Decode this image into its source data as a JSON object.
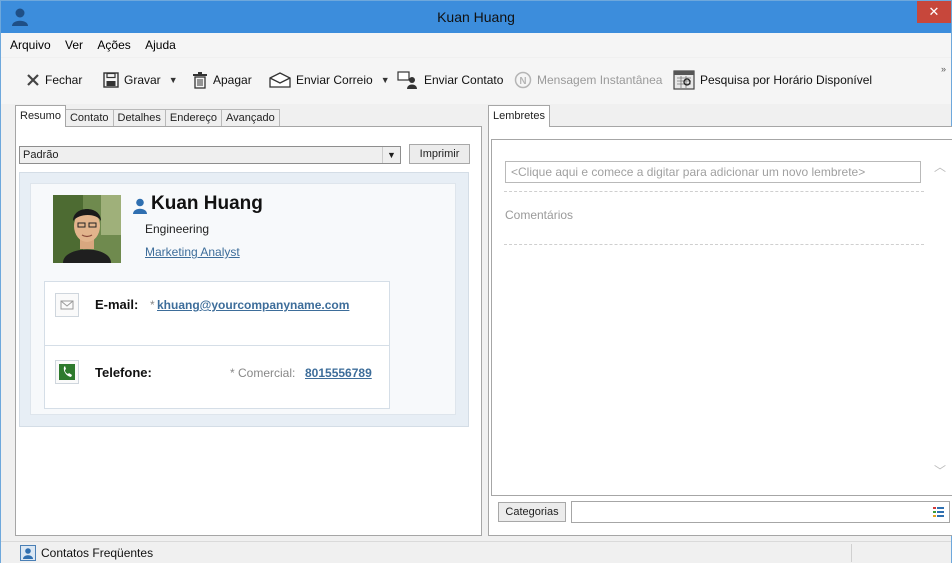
{
  "window": {
    "title": "Kuan Huang",
    "close_glyph": "✕",
    "accent": "#3c8ddc"
  },
  "menu": [
    "Arquivo",
    "Ver",
    "Ações",
    "Ajuda"
  ],
  "toolbar": {
    "close_label": "Fechar",
    "save_label": "Gravar",
    "delete_label": "Apagar",
    "send_mail_label": "Enviar Correio",
    "send_contact_label": "Enviar Contato",
    "im_label": "Mensagem Instantânea",
    "availability_label": "Pesquisa por Horário Disponível",
    "more_glyph": "»"
  },
  "left": {
    "tabs": [
      "Resumo",
      "Contato",
      "Detalhes",
      "Endereço",
      "Avançado"
    ],
    "view_value": "Padrão",
    "print_label": "Imprimir",
    "card": {
      "name": "Kuan Huang",
      "department": "Engineering",
      "role": "Marketing Analyst",
      "email_label": "E-mail:",
      "email_star": "*",
      "email": "khuang@yourcompanyname.com",
      "phone_label": "Telefone:",
      "phone_type": "* Comercial:",
      "phone": "8015556789"
    }
  },
  "right": {
    "tab": "Lembretes",
    "reminder_placeholder": "<Clique aqui e comece a digitar para adicionar um novo lembrete>",
    "comments_label": "Comentários",
    "categories_label": "Categorias",
    "scroll_up": "︿",
    "scroll_down": "﹀"
  },
  "status": {
    "text": "Contatos Freqüentes"
  }
}
